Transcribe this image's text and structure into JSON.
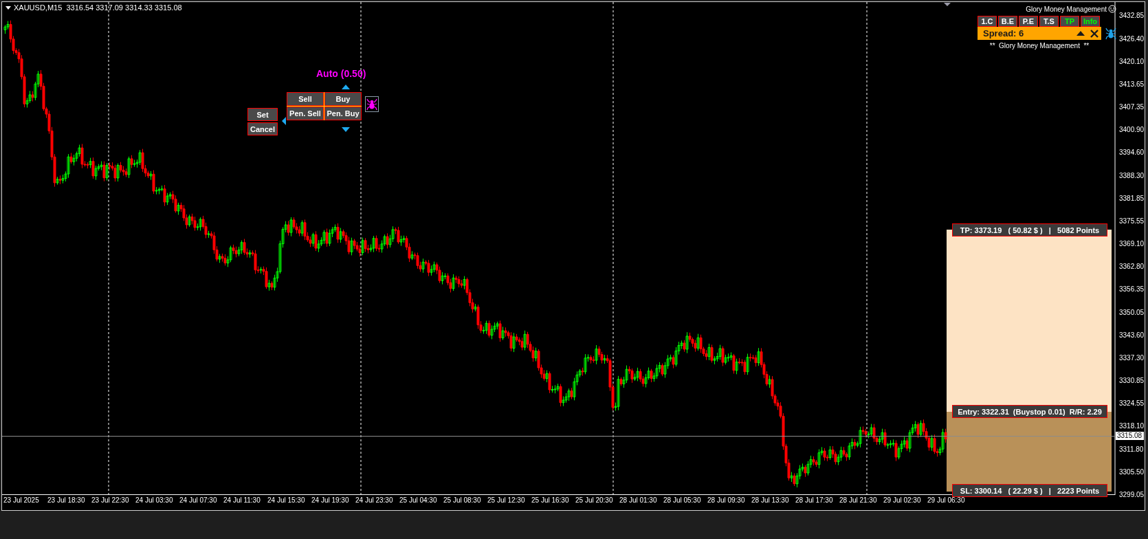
{
  "chart": {
    "header": "XAUUSD,M15  3316.54 3317.09 3314.33 3315.08",
    "price_axis": [
      "3432.85",
      "3426.40",
      "3420.10",
      "3413.65",
      "3407.35",
      "3400.90",
      "3394.60",
      "3388.30",
      "3381.85",
      "3375.55",
      "3369.10",
      "3362.80",
      "3356.35",
      "3350.05",
      "3343.60",
      "3337.30",
      "3330.85",
      "3324.55",
      "3318.10",
      "3311.80",
      "3305.50",
      "3299.05"
    ],
    "current_price": "3315.08",
    "time_axis": [
      "23 Jul 2025",
      "23 Jul 18:30",
      "23 Jul 22:30",
      "24 Jul 03:30",
      "24 Jul 07:30",
      "24 Jul 11:30",
      "24 Jul 15:30",
      "24 Jul 19:30",
      "24 Jul 23:30",
      "25 Jul 04:30",
      "25 Jul 08:30",
      "25 Jul 12:30",
      "25 Jul 16:30",
      "25 Jul 20:30",
      "28 Jul 01:30",
      "28 Jul 05:30",
      "28 Jul 09:30",
      "28 Jul 13:30",
      "28 Jul 17:30",
      "28 Jul 21:30",
      "29 Jul 02:30",
      "29 Jul 06:30"
    ]
  },
  "indicator": {
    "title": "Glory Money Management",
    "buttons": [
      {
        "label": "1.C",
        "active": false
      },
      {
        "label": "B.E",
        "active": false
      },
      {
        "label": "P.E",
        "active": false
      },
      {
        "label": "T.S",
        "active": false
      },
      {
        "label": "TP",
        "active": true
      },
      {
        "label": "Info",
        "active": true
      }
    ],
    "spread": "Spread: 6",
    "footer": "**  Glory Money Management  **"
  },
  "order_panel": {
    "lot": "Auto (0.50)",
    "market_buttons": [
      "Sell",
      "Buy"
    ],
    "pending_buttons": [
      "Pen. Sell",
      "Pen. Buy"
    ],
    "action_buttons": [
      "Set",
      "Cancel"
    ]
  },
  "position": {
    "take_profit": "TP: 3373.19   ( 50.82 $ )   |   5082 Points",
    "entry": "Entry: 3322.31  (Buystop 0.01)  R/R: 2.29",
    "stop_loss": "SL: 3300.14   ( 22.29 $ )   |   2223 Points"
  }
}
